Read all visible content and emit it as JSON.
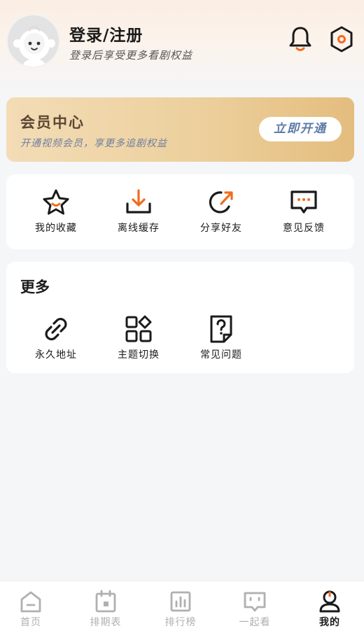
{
  "header": {
    "title": "登录/注册",
    "subtitle": "登录后享受更多看剧权益",
    "icons": [
      "bell-icon",
      "settings-icon"
    ]
  },
  "vip": {
    "title": "会员中心",
    "subtitle": "开通视频会员，享更多追剧权益",
    "button": "立即开通"
  },
  "quick_actions": [
    {
      "label": "我的收藏",
      "icon": "star-icon"
    },
    {
      "label": "离线缓存",
      "icon": "download-icon"
    },
    {
      "label": "分享好友",
      "icon": "share-icon"
    },
    {
      "label": "意见反馈",
      "icon": "feedback-icon"
    }
  ],
  "more": {
    "title": "更多",
    "items": [
      {
        "label": "永久地址",
        "icon": "link-icon"
      },
      {
        "label": "主题切换",
        "icon": "theme-icon"
      },
      {
        "label": "常见问题",
        "icon": "faq-icon"
      }
    ]
  },
  "bottom_nav": [
    {
      "label": "首页",
      "icon": "home-icon",
      "active": false
    },
    {
      "label": "排期表",
      "icon": "calendar-icon",
      "active": false
    },
    {
      "label": "排行榜",
      "icon": "ranking-icon",
      "active": false
    },
    {
      "label": "一起看",
      "icon": "watch-together-icon",
      "active": false
    },
    {
      "label": "我的",
      "icon": "profile-icon",
      "active": true
    }
  ],
  "colors": {
    "accent": "#f26b1d",
    "vip_gradient_start": "#f3dcb6",
    "vip_gradient_end": "#e4bd7e",
    "vip_button_text": "#5c7ba8",
    "inactive_nav": "#b0b0b0"
  }
}
